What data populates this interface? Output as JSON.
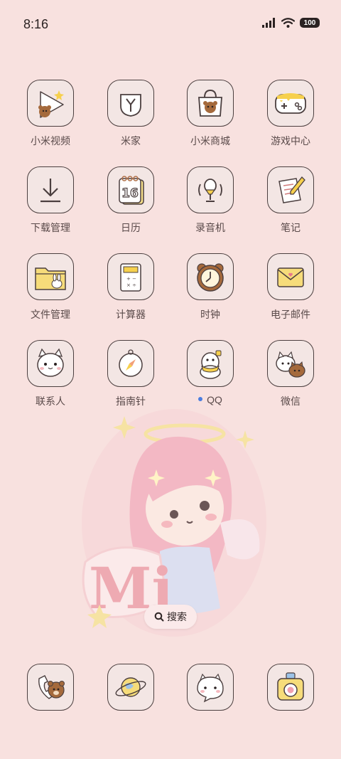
{
  "status": {
    "time": "8:16",
    "battery": "100"
  },
  "apps": [
    {
      "label": "小米视频",
      "icon": "video-icon"
    },
    {
      "label": "米家",
      "icon": "mijia-icon"
    },
    {
      "label": "小米商城",
      "icon": "shop-bag-icon"
    },
    {
      "label": "游戏中心",
      "icon": "gamepad-icon"
    },
    {
      "label": "下载管理",
      "icon": "download-icon"
    },
    {
      "label": "日历",
      "icon": "calendar-icon"
    },
    {
      "label": "录音机",
      "icon": "microphone-icon"
    },
    {
      "label": "笔记",
      "icon": "note-pencil-icon"
    },
    {
      "label": "文件管理",
      "icon": "folder-icon"
    },
    {
      "label": "计算器",
      "icon": "calculator-icon"
    },
    {
      "label": "时钟",
      "icon": "clock-icon"
    },
    {
      "label": "电子邮件",
      "icon": "mail-icon"
    },
    {
      "label": "联系人",
      "icon": "cat-contacts-icon"
    },
    {
      "label": "指南针",
      "icon": "compass-icon"
    },
    {
      "label": "QQ",
      "icon": "qq-penguin-icon"
    },
    {
      "label": "微信",
      "icon": "wechat-cats-icon"
    }
  ],
  "calendar_day": "16",
  "search": {
    "label": "搜索"
  },
  "dock": [
    {
      "icon": "phone-bear-icon"
    },
    {
      "icon": "browser-planet-icon"
    },
    {
      "icon": "message-cat-icon"
    },
    {
      "icon": "camera-icon"
    }
  ]
}
